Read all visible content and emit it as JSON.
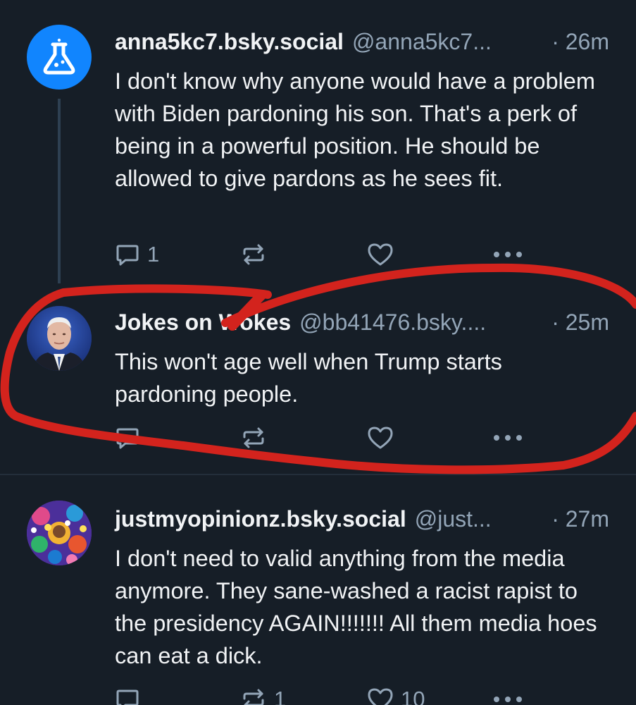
{
  "posts": [
    {
      "display_name": "anna5kc7.bsky.social",
      "handle": "@anna5kc7...",
      "time": "· 26m",
      "text": "I don't know why anyone would have a problem with Biden pardoning his son. That's a perk of being in a powerful position. He should be allowed to give pardons as he sees fit.",
      "reply_count": "1",
      "repost_count": "",
      "like_count": "",
      "avatar": "flask-icon"
    },
    {
      "display_name": "Jokes on Wokes",
      "handle": "@bb41476.bsky....",
      "time": "· 25m",
      "text": "This won't age well when Trump starts pardoning people.",
      "reply_count": "",
      "repost_count": "",
      "like_count": "",
      "avatar": "profile-photo"
    },
    {
      "display_name": "justmyopinionz.bsky.social",
      "handle": "@just...",
      "time": "· 27m",
      "text": "I don't need to valid anything from the media anymore. They sane-washed a racist rapist to the presidency AGAIN!!!!!!! All them media hoes can eat a dick.",
      "reply_count": "",
      "repost_count": "1",
      "like_count": "10",
      "avatar": "illustrated-avatar"
    }
  ],
  "colors": {
    "background": "#161e27",
    "text": "#f1f3f5",
    "muted": "#93a5b7",
    "avatar_blue": "#1185fe",
    "annotation_red": "#d3231d"
  },
  "icons": {
    "reply": "speech-bubble-icon",
    "repost": "repost-arrows-icon",
    "like": "heart-icon",
    "more": "ellipsis-icon"
  }
}
